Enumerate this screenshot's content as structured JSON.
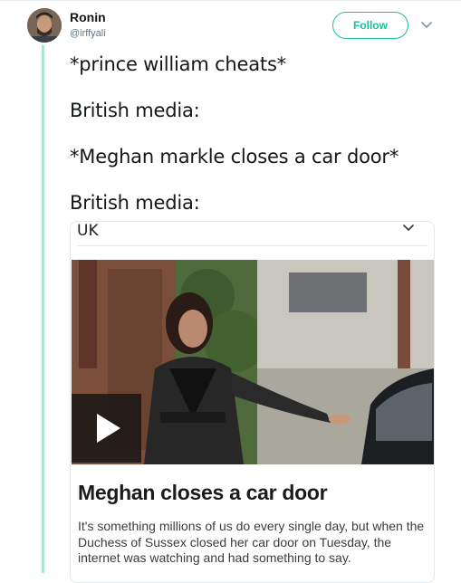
{
  "author": {
    "name": "Ronin",
    "handle": "@irffyali"
  },
  "header": {
    "follow_label": "Follow",
    "menu_icon": "chevron-down-icon"
  },
  "tweet": {
    "lines": [
      "*prince william cheats*",
      "British media:",
      "*Meghan markle closes a car door*",
      "British media:"
    ]
  },
  "card": {
    "region_label": "UK",
    "region_icon": "chevron-down-icon",
    "media_icon": "play-icon",
    "title": "Meghan closes a car door",
    "description": "It's something millions of us do every single day, but when the Duchess of Sussex closed her car door on Tuesday, the internet was watching and had something to say."
  },
  "colors": {
    "accent": "#1dbf9f",
    "thread_line": "#a7e8d8",
    "text": "#14171a",
    "muted": "#657786"
  }
}
